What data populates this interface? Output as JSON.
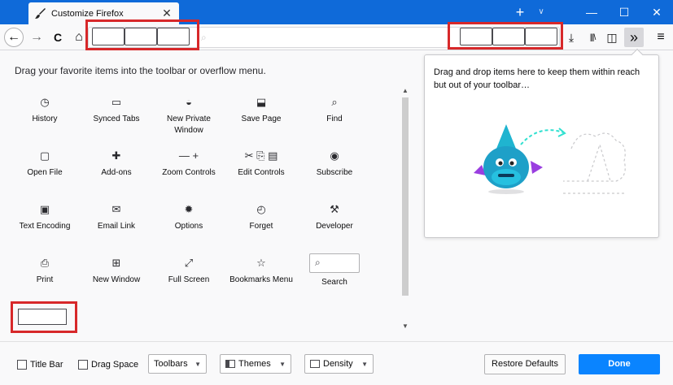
{
  "window": {
    "tab_title": "Customize Firefox",
    "tab_close": "✕",
    "new_tab": "+",
    "tab_menu": "∨",
    "minimize": "—",
    "maximize": "☐",
    "close": "✕"
  },
  "toolbar": {
    "back": "←",
    "forward": "→",
    "reload": "C",
    "home": "⌂",
    "library": "|||\\",
    "sidebar": "◫",
    "overflow": "»",
    "menu": "≡",
    "download": "⤓"
  },
  "main": {
    "hint": "Drag your favorite items into the toolbar or overflow menu.",
    "items": [
      {
        "label": "History",
        "icon": "◷"
      },
      {
        "label": "Synced Tabs",
        "icon": "▭"
      },
      {
        "label": "New Private Window",
        "icon": "◒"
      },
      {
        "label": "Save Page",
        "icon": "⬓"
      },
      {
        "label": "Find",
        "icon": "⌕"
      },
      {
        "label": "Open File",
        "icon": "▢"
      },
      {
        "label": "Add-ons",
        "icon": "✚"
      },
      {
        "label": "Zoom Controls",
        "icon": "— +"
      },
      {
        "label": "Edit Controls",
        "icon": "✂ ⎘ ▤"
      },
      {
        "label": "Subscribe",
        "icon": "◉"
      },
      {
        "label": "Text Encoding",
        "icon": "▣"
      },
      {
        "label": "Email Link",
        "icon": "✉"
      },
      {
        "label": "Options",
        "icon": "✹"
      },
      {
        "label": "Forget",
        "icon": "◴"
      },
      {
        "label": "Developer",
        "icon": "⚒"
      },
      {
        "label": "Print",
        "icon": "⎙"
      },
      {
        "label": "New Window",
        "icon": "⊞"
      },
      {
        "label": "Full Screen",
        "icon": "⤢"
      },
      {
        "label": "Bookmarks Menu",
        "icon": "☆"
      }
    ],
    "search_label": "Search",
    "search_icon": "⌕"
  },
  "overflow": {
    "text": "Drag and drop items here to keep them within reach but out of your toolbar…"
  },
  "footer": {
    "title_bar": "Title Bar",
    "drag_space": "Drag Space",
    "toolbars": "Toolbars",
    "themes": "Themes",
    "density": "Density",
    "restore": "Restore Defaults",
    "done": "Done"
  },
  "colors": {
    "titlebar": "#0f6ad9",
    "highlight": "#d7282a",
    "done": "#0a84ff"
  }
}
